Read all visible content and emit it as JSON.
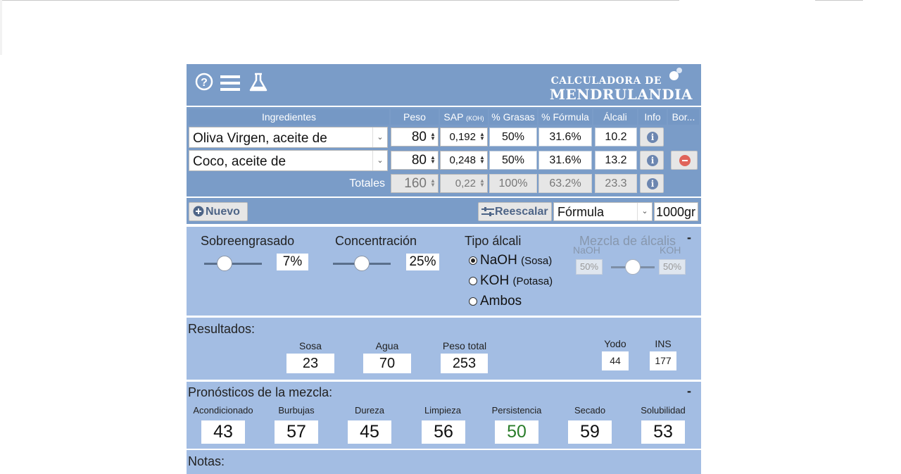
{
  "header": {
    "brand_line1": "CALCULADORA DE",
    "brand_line2": "MENDRULANDIA",
    "icons": [
      "help-icon",
      "menu-icon",
      "flask-icon"
    ]
  },
  "table": {
    "headers": {
      "ingredientes": "Ingredientes",
      "peso": "Peso",
      "sap": "SAP",
      "sap_unit": "(KOH)",
      "grasas": "% Grasas",
      "formula": "% Fórmula",
      "alcali": "Álcali",
      "info": "Info",
      "borrar": "Bor..."
    },
    "rows": [
      {
        "ingrediente": "Oliva Virgen, aceite de",
        "peso": "80",
        "sap": "0,192",
        "grasas": "50%",
        "formula": "31.6%",
        "alcali": "10.2"
      },
      {
        "ingrediente": "Coco, aceite de",
        "peso": "80",
        "sap": "0,248",
        "grasas": "50%",
        "formula": "31.6%",
        "alcali": "13.2"
      }
    ],
    "totals": {
      "label": "Totales",
      "peso": "160",
      "sap": "0,22",
      "grasas": "100%",
      "formula": "63.2%",
      "alcali": "23.3"
    }
  },
  "toolbar": {
    "nuevo": "Nuevo",
    "reescalar": "Reescalar",
    "mode_value": "Fórmula",
    "amount_value": "1000gr"
  },
  "settings": {
    "sobreengrasado": {
      "label": "Sobreengrasado",
      "value": "7%",
      "level": 0.3
    },
    "concentracion": {
      "label": "Concentración",
      "value": "25%",
      "level": 0.5
    },
    "tipo_alcali": {
      "label": "Tipo álcali",
      "options": [
        {
          "main": "NaOH",
          "sub": "(Sosa)",
          "selected": true
        },
        {
          "main": "KOH",
          "sub": "(Potasa)",
          "selected": false
        },
        {
          "main": "Ambos",
          "sub": "",
          "selected": false
        }
      ]
    },
    "mezcla": {
      "label": "Mezcla de álcalis",
      "naoh_label": "NaOH",
      "koh_label": "KOH",
      "naoh_value": "50%",
      "koh_value": "50%",
      "level": 0.5,
      "collapse": "-"
    }
  },
  "resultados": {
    "title": "Resultados:",
    "sosa_label": "Sosa",
    "sosa": "23",
    "agua_label": "Agua",
    "agua": "70",
    "total_label": "Peso total",
    "total": "253",
    "yodo_label": "Yodo",
    "yodo": "44",
    "ins_label": "INS",
    "ins": "177"
  },
  "pronosticos": {
    "title": "Pronósticos de la mezcla:",
    "collapse": "-",
    "items": [
      {
        "label": "Acondicionado",
        "value": "43"
      },
      {
        "label": "Burbujas",
        "value": "57"
      },
      {
        "label": "Dureza",
        "value": "45"
      },
      {
        "label": "Limpieza",
        "value": "56"
      },
      {
        "label": "Persistencia",
        "value": "50"
      },
      {
        "label": "Secado",
        "value": "59"
      },
      {
        "label": "Solubilidad",
        "value": "53"
      }
    ],
    "highlight_color": "#2a7d2a"
  },
  "notas": {
    "title": "Notas:"
  },
  "colors": {
    "header_bg": "#7a9cc8",
    "panel_bg": "#a3bde3",
    "info_blue": "#6c86b0",
    "delete_red": "#e0645a"
  }
}
